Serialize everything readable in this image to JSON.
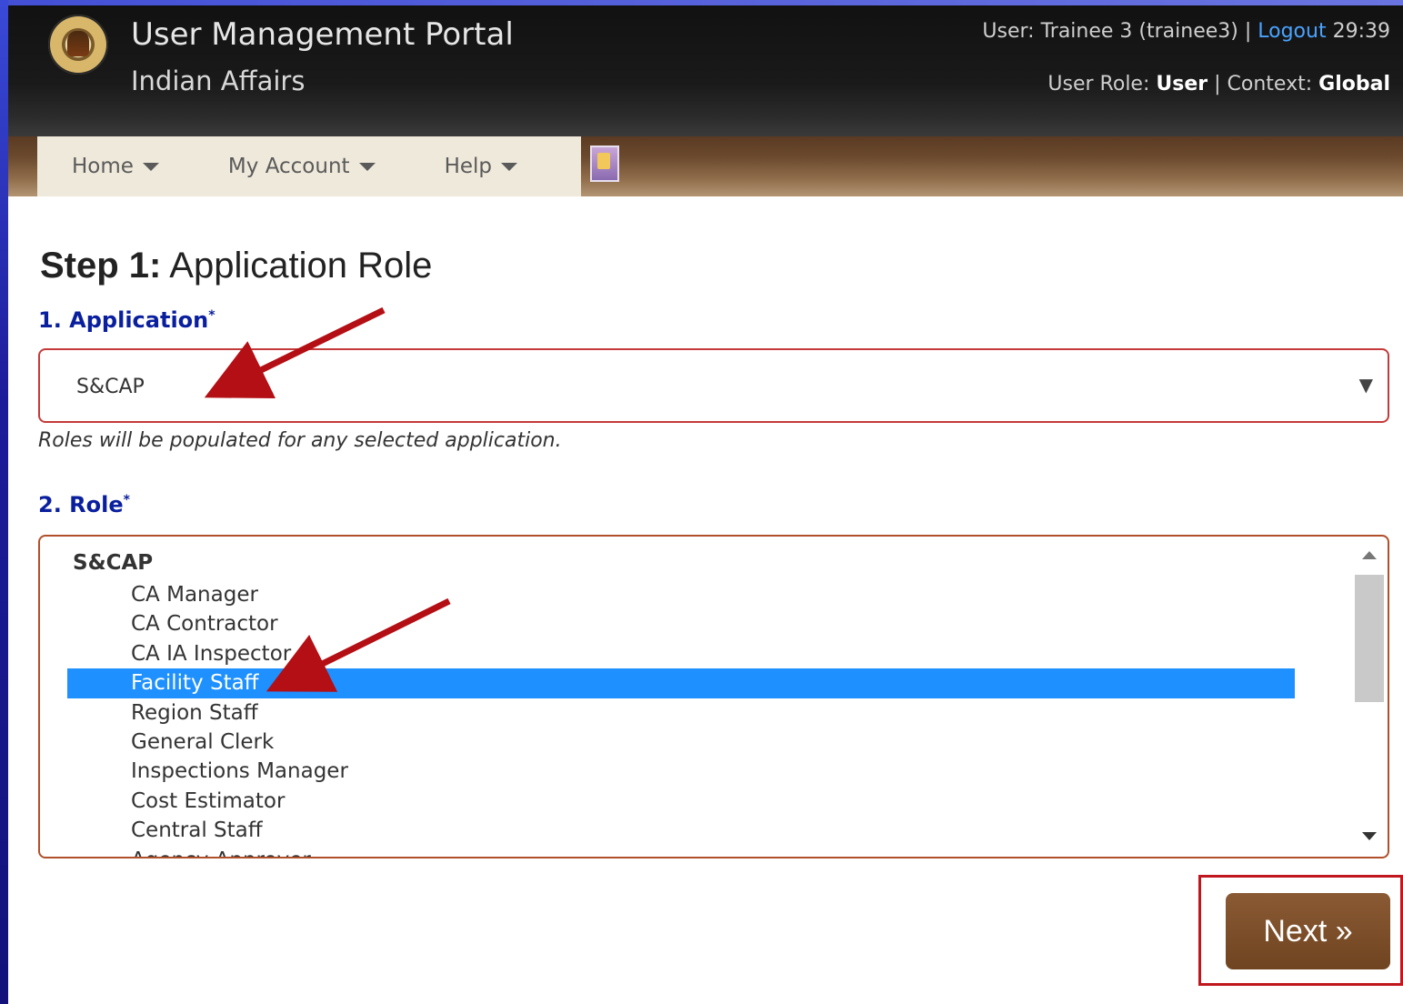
{
  "header": {
    "title": "User Management Portal",
    "subtitle": "Indian Affairs",
    "user_prefix": "User: Trainee 3 (trainee3) |",
    "logout_label": "Logout",
    "timer": "29:39",
    "role_prefix": "User Role:",
    "role_value": "User",
    "context_prefix": "| Context:",
    "context_value": "Global"
  },
  "nav": {
    "items": [
      {
        "label": "Home"
      },
      {
        "label": "My Account"
      },
      {
        "label": "Help"
      }
    ]
  },
  "step": {
    "number": "Step 1:",
    "title": "Application Role"
  },
  "application": {
    "label": "1. Application",
    "required": "*",
    "selected": "S&CAP",
    "help": "Roles will be populated for any selected application."
  },
  "role": {
    "label": "2. Role",
    "required": "*",
    "group": "S&CAP",
    "options": [
      "CA Manager",
      "CA Contractor",
      "CA IA Inspector",
      "Facility Staff",
      "Region Staff",
      "General Clerk",
      "Inspections Manager",
      "Cost Estimator",
      "Central Staff",
      "Agency Approver"
    ],
    "selected": "Facility Staff"
  },
  "actions": {
    "next_label": "Next »"
  },
  "colors": {
    "accent_blue": "#1e90ff",
    "label_blue": "#0a1f9e",
    "brand_brown": "#7a4c28",
    "highlight_red": "#c0161e"
  }
}
